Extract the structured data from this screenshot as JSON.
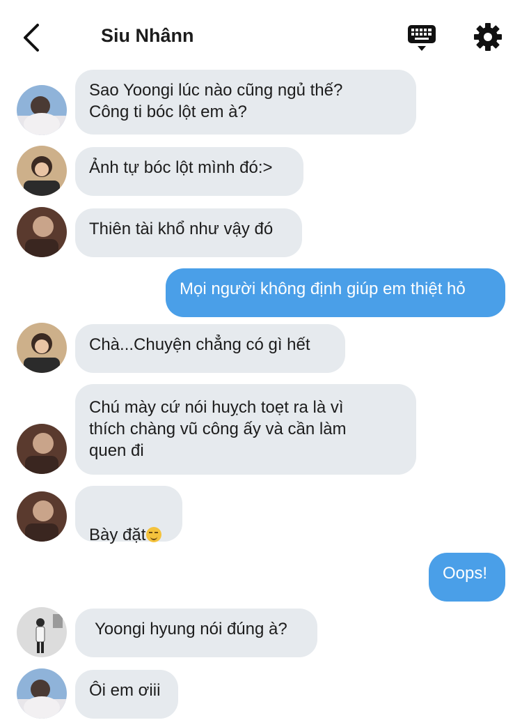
{
  "header": {
    "title": "Siu Nhânn"
  },
  "icons": {
    "back": "chevron-left-icon",
    "keyboard": "keyboard-icon",
    "settings": "gear-icon"
  },
  "colors": {
    "incoming_bubble": "#e6eaee",
    "outgoing_bubble": "#4a9fe8",
    "outgoing_text": "#ffffff"
  },
  "messages": [
    {
      "side": "in",
      "avatar": "avatar-yoongi",
      "text": "Sao Yoongi lúc nào cũng ngủ thế?\nCông ti bóc lột em à?"
    },
    {
      "side": "in",
      "avatar": "avatar-hoseok",
      "text": "Ảnh tự bóc lột mình đó:>"
    },
    {
      "side": "in",
      "avatar": "avatar-jimin",
      "text": "Thiên tài khổ như vậy đó"
    },
    {
      "side": "out",
      "text": "Mọi người không định giúp em thiệt hỏ"
    },
    {
      "side": "in",
      "avatar": "avatar-hoseok",
      "text": "Chà...Chuyện chẳng có gì hết"
    },
    {
      "side": "in",
      "avatar": "avatar-jimin",
      "text": "Chú mày cứ nói huỵch toẹt ra là vì\nthích chàng vũ công ấy và cần làm\nquen đi"
    },
    {
      "side": "in",
      "avatar": "avatar-jimin",
      "text": "Bày đặt",
      "emoji": "smirk-emoji"
    },
    {
      "side": "out",
      "text": "Oops!"
    },
    {
      "side": "in",
      "avatar": "avatar-jungkook",
      "text": "Yoongi hyung nói đúng à?"
    },
    {
      "side": "in",
      "avatar": "avatar-yoongi",
      "text": "Ôi em ơiii"
    }
  ]
}
